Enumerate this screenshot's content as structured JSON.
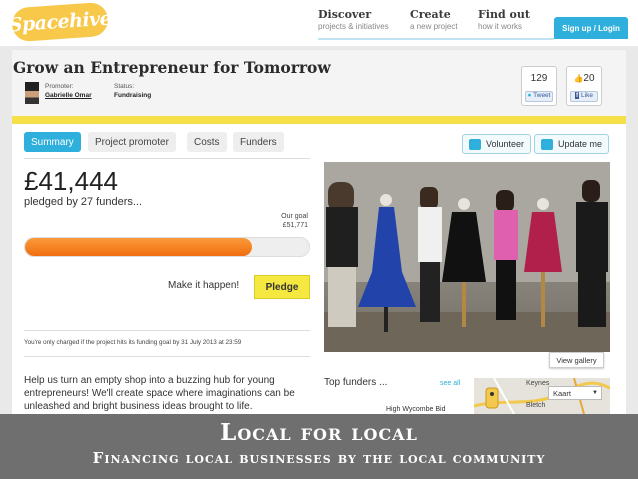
{
  "header": {
    "logo": "Spacehive",
    "nav": [
      {
        "title": "Discover",
        "subtitle": "projects & initiatives"
      },
      {
        "title": "Create",
        "subtitle": "a new project"
      },
      {
        "title": "Find out",
        "subtitle": "how it works"
      }
    ],
    "signup_label": "Sign up / Login"
  },
  "project": {
    "title": "Grow an Entrepreneur for Tomorrow",
    "promoter_label": "Promoter:",
    "promoter_name": "Gabrielle Omar",
    "status_label": "Status:",
    "status_value": "Fundraising"
  },
  "social": {
    "tweets": "129",
    "tweet_label": "Tweet",
    "likes": "20",
    "like_label": "Like"
  },
  "tabs": [
    "Summary",
    "Project promoter",
    "Costs",
    "Funders"
  ],
  "actions": {
    "volunteer": "Volunteer",
    "update": "Update me"
  },
  "funding": {
    "amount": "£41,444",
    "pledged_text": "pledged by 27 funders...",
    "goal_label": "Our goal",
    "goal_value": "£51,771",
    "progress_fraction": 0.8,
    "cta_text": "Make it happen!",
    "pledge_label": "Pledge",
    "charged_note": "You're only charged if the project hits its funding goal by 31 July 2013 at 23:59"
  },
  "description": "Help us turn an empty shop into a buzzing hub for young entrepreneurs! We'll create space where imaginations can be unleashed and bright business ideas brought to life.",
  "gallery": {
    "view_label": "View gallery"
  },
  "top_funders": {
    "title": "Top funders ...",
    "see_all": "see all",
    "first": "High Wycombe Bid"
  },
  "map": {
    "type_label": "Kaart",
    "place1": "Keynes",
    "place2": "Bletch"
  },
  "caption": {
    "title": "Local for local",
    "subtitle": "Financing local businesses by the local community"
  },
  "colors": {
    "accent": "#2fb0dc",
    "highlight": "#f5e04a",
    "progress": "#f47c1e"
  }
}
